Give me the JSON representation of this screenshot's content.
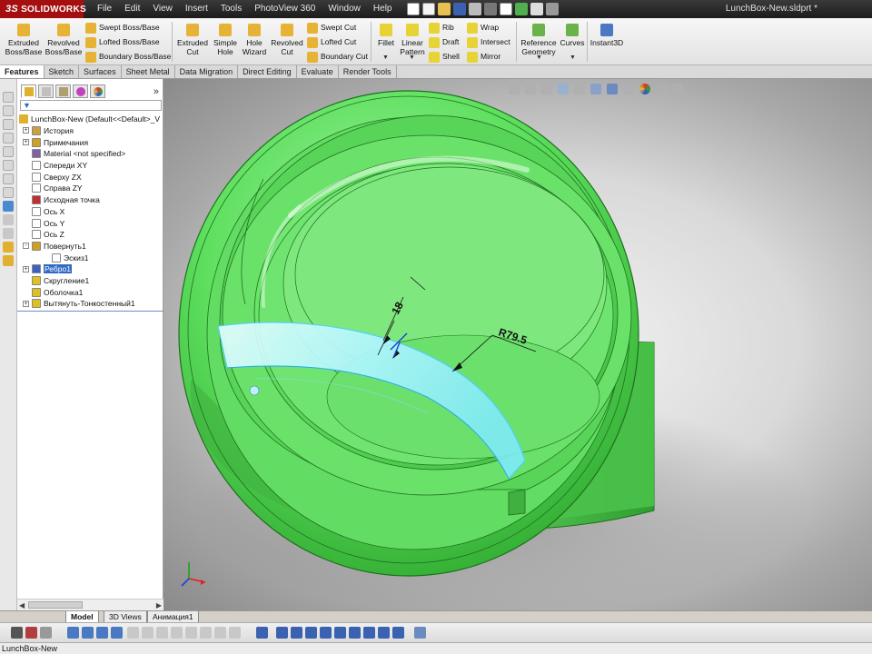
{
  "app": {
    "logo_text": "SOLIDWORKS",
    "logo_prefix": "3S",
    "filename": "LunchBox-New.sldprt *"
  },
  "menu": [
    "File",
    "Edit",
    "View",
    "Insert",
    "Tools",
    "PhotoView 360",
    "Window",
    "Help"
  ],
  "command_manager": {
    "extruded_boss": "Extruded Boss/Base",
    "revolved_boss": "Revolved Boss/Base",
    "swept_boss": "Swept Boss/Base",
    "lofted_boss": "Lofted Boss/Base",
    "boundary_boss": "Boundary Boss/Base",
    "extruded_cut": "Extruded Cut",
    "simple_hole": "Simple Hole",
    "hole_wizard": "Hole Wizard",
    "revolved_cut": "Revolved Cut",
    "swept_cut": "Swept Cut",
    "lofted_cut": "Lofted Cut",
    "boundary_cut": "Boundary Cut",
    "fillet": "Fillet",
    "linear_pattern": "Linear Pattern",
    "rib": "Rib",
    "draft": "Draft",
    "shell": "Shell",
    "wrap": "Wrap",
    "intersect": "Intersect",
    "mirror": "Mirror",
    "reference_geometry": "Reference Geometry",
    "curves": "Curves",
    "instant3d": "Instant3D"
  },
  "tabs": [
    "Features",
    "Sketch",
    "Surfaces",
    "Sheet Metal",
    "Data Migration",
    "Direct Editing",
    "Evaluate",
    "Render Tools"
  ],
  "active_tab": "Features",
  "feature_tree": {
    "root": "LunchBox-New  (Default<<Default>_V",
    "items": [
      {
        "label": "История",
        "expand": "+",
        "color": "#c8a040"
      },
      {
        "label": "Примечания",
        "expand": "+",
        "color": "#d0a020"
      },
      {
        "label": "Material <not specified>",
        "expand": "",
        "color": "#8060a0"
      },
      {
        "label": "Спереди XY",
        "expand": "",
        "color": "#ffffff"
      },
      {
        "label": "Сверху ZX",
        "expand": "",
        "color": "#ffffff"
      },
      {
        "label": "Справа ZY",
        "expand": "",
        "color": "#ffffff"
      },
      {
        "label": "Исходная точка",
        "expand": "",
        "color": "#c03030"
      },
      {
        "label": "Ось X",
        "expand": "",
        "color": "#ffffff"
      },
      {
        "label": "Ось Y",
        "expand": "",
        "color": "#ffffff"
      },
      {
        "label": "Ось Z",
        "expand": "",
        "color": "#ffffff"
      },
      {
        "label": "Повернуть1",
        "expand": "-",
        "color": "#d0a020"
      },
      {
        "label": "Эскиз1",
        "expand": "",
        "color": "#ffffff"
      },
      {
        "label": "Ребро1",
        "expand": "+",
        "color": "#4060c0",
        "selected": true
      },
      {
        "label": "Скругление1",
        "expand": "",
        "color": "#e0c020"
      },
      {
        "label": "Оболочка1",
        "expand": "",
        "color": "#e0c020"
      },
      {
        "label": "Вытянуть-Тонкостенный1",
        "expand": "+",
        "color": "#e0c020"
      }
    ]
  },
  "model": {
    "dimension_thickness": "18",
    "dimension_radius": "R79.5",
    "body_color": "#5de05d",
    "highlight_color": "#aef6ff"
  },
  "bottom_tabs": [
    "Model",
    "3D Views",
    "Анимация1"
  ],
  "active_bottom_tab": "Model",
  "status": "LunchBox-New"
}
